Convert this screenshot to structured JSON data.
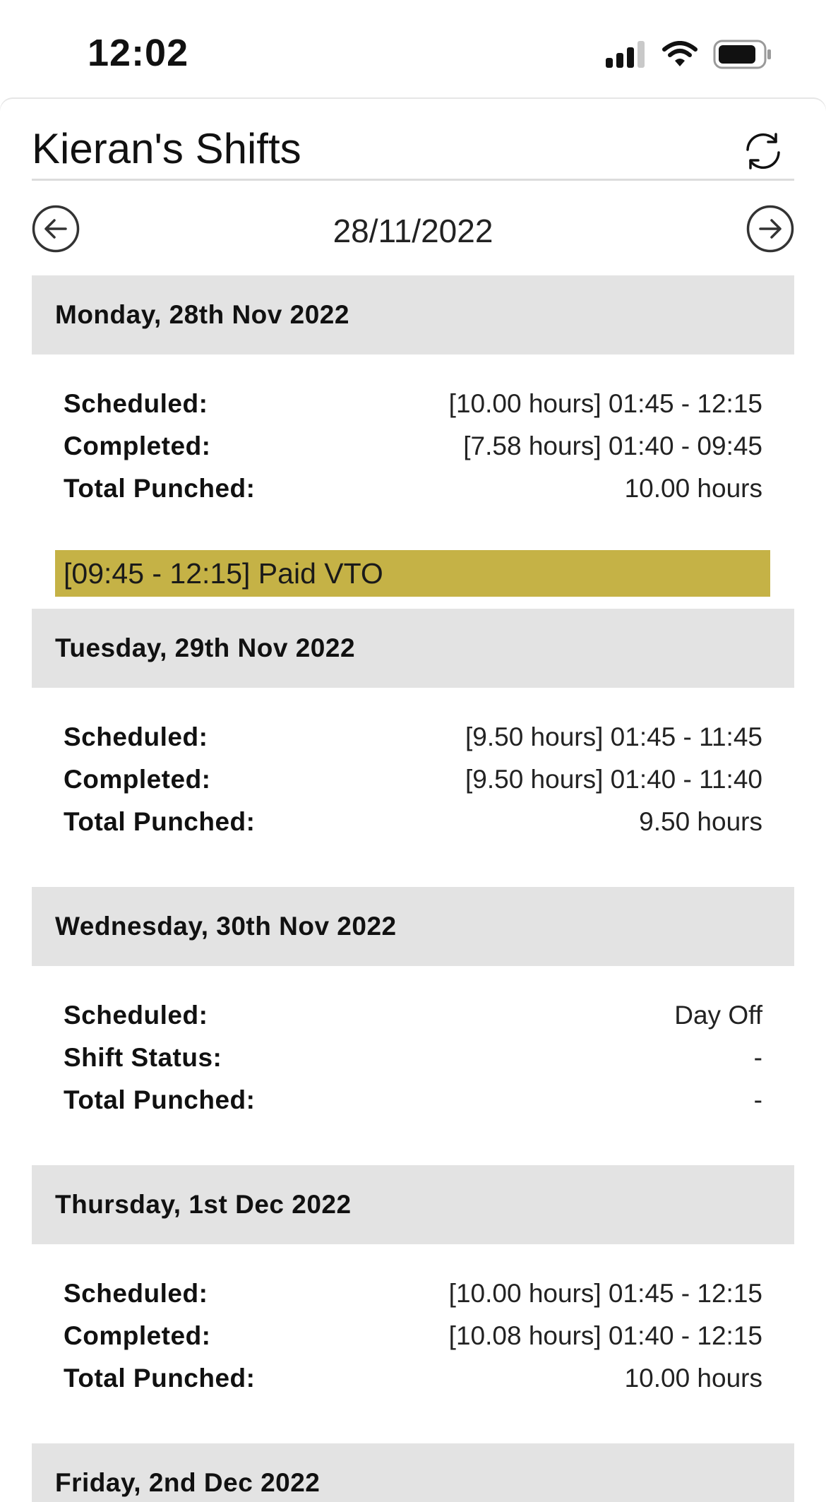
{
  "status_bar": {
    "time": "12:02"
  },
  "header": {
    "title": "Kieran's Shifts"
  },
  "date_nav": {
    "date": "28/11/2022"
  },
  "days": [
    {
      "title": "Monday, 28th Nov 2022",
      "rows": [
        {
          "label": "Scheduled:",
          "value": "[10.00 hours] 01:45 - 12:15"
        },
        {
          "label": "Completed:",
          "value": "[7.58 hours] 01:40 - 09:45"
        },
        {
          "label": "Total Punched:",
          "value": "10.00 hours"
        }
      ],
      "tag": "[09:45 - 12:15] Paid VTO"
    },
    {
      "title": "Tuesday, 29th Nov 2022",
      "rows": [
        {
          "label": "Scheduled:",
          "value": "[9.50 hours] 01:45 - 11:45"
        },
        {
          "label": "Completed:",
          "value": "[9.50 hours] 01:40 - 11:40"
        },
        {
          "label": "Total Punched:",
          "value": "9.50 hours"
        }
      ]
    },
    {
      "title": "Wednesday, 30th Nov 2022",
      "rows": [
        {
          "label": "Scheduled:",
          "value": "Day Off"
        },
        {
          "label": "Shift Status:",
          "value": "-"
        },
        {
          "label": "Total Punched:",
          "value": "-"
        }
      ]
    },
    {
      "title": "Thursday, 1st Dec 2022",
      "rows": [
        {
          "label": "Scheduled:",
          "value": "[10.00 hours] 01:45 - 12:15"
        },
        {
          "label": "Completed:",
          "value": "[10.08 hours] 01:40 - 12:15"
        },
        {
          "label": "Total Punched:",
          "value": "10.00 hours"
        }
      ]
    },
    {
      "title": "Friday, 2nd Dec 2022"
    }
  ],
  "colors": {
    "vto_tag": "#c5b246",
    "day_header_bg": "#e3e3e3"
  },
  "icons": [
    "cellular-signal-icon",
    "wifi-icon",
    "battery-icon",
    "refresh-icon",
    "arrow-left-circle-icon",
    "arrow-right-circle-icon"
  ]
}
